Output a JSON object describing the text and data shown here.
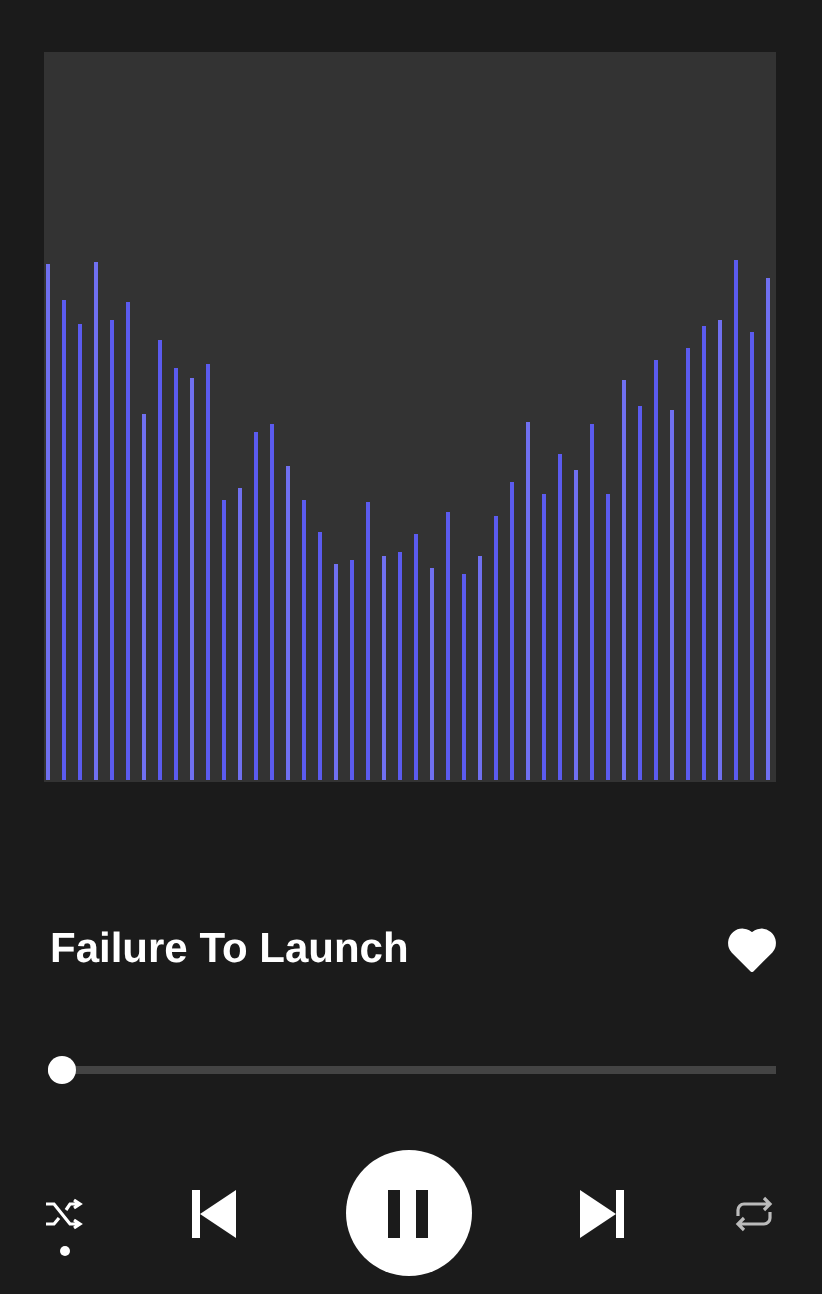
{
  "track": {
    "title": "Failure To Launch",
    "liked": true
  },
  "progress": {
    "level": 0.02
  },
  "controls": {
    "shuffle_on": true,
    "repeat_on": false,
    "playing": true
  }
}
